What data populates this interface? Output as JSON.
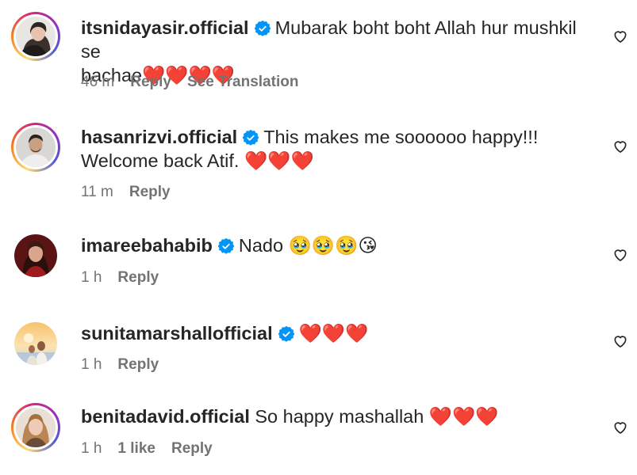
{
  "comments": [
    {
      "username": "itsnidayasir.official",
      "verified": true,
      "text": "Mubarak boht boht Allah hur mushkil se",
      "text_line2": "bachae",
      "hearts": "❤️❤️❤️❤️",
      "time": "46 m",
      "reply": "Reply",
      "translate": "See Translation",
      "avatar": "woman-portrait-avatar",
      "story_ring": true
    },
    {
      "username": "hasanrizvi.official",
      "verified": true,
      "text": "This makes me soooooo happy!!!",
      "text_line2": "Welcome back Atif.",
      "hearts": "❤️❤️❤️",
      "time": "11 m",
      "reply": "Reply",
      "avatar": "man-portrait-avatar",
      "story_ring": true
    },
    {
      "username": "imareebahabib",
      "verified": true,
      "text": "Nado",
      "emojis": "🥹🥹🥹😘",
      "time": "1 h",
      "reply": "Reply",
      "avatar": "woman-red-portrait-avatar",
      "story_ring": false
    },
    {
      "username": "sunitamarshallofficial",
      "verified": true,
      "hearts": "❤️❤️❤️",
      "time": "1 h",
      "reply": "Reply",
      "avatar": "sunset-couple-avatar",
      "story_ring": false
    },
    {
      "username": "benitadavid.official",
      "verified": false,
      "text": "So happy mashallah",
      "hearts": "❤️❤️❤️",
      "time": "1 h",
      "likes": "1 like",
      "reply": "Reply",
      "avatar": "woman-blonde-portrait-avatar",
      "story_ring": true
    }
  ],
  "colors": {
    "text": "#262626",
    "meta": "#737373",
    "verified_blue": "#0095f6",
    "story_ring_start": "#feda75",
    "story_ring_end": "#962fbf"
  },
  "icons": {
    "verified": "verified-badge-icon",
    "like": "heart-outline-icon"
  }
}
